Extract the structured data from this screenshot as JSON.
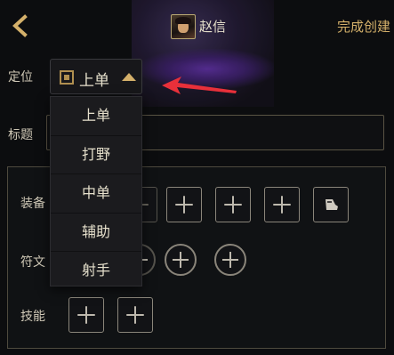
{
  "header": {
    "back_icon": "chevron-left-icon",
    "hero_name": "赵信",
    "finish_label": "完成创建"
  },
  "position": {
    "label": "定位",
    "selected": "上单",
    "options": [
      "上单",
      "打野",
      "中单",
      "辅助",
      "射手"
    ]
  },
  "title": {
    "label": "标题",
    "value": ""
  },
  "config": {
    "equipment_label": "装备",
    "rune_label": "符文",
    "skill_label": "技能"
  },
  "colors": {
    "accent_gold": "#d4b06a",
    "annotation_red": "#e8303a"
  }
}
